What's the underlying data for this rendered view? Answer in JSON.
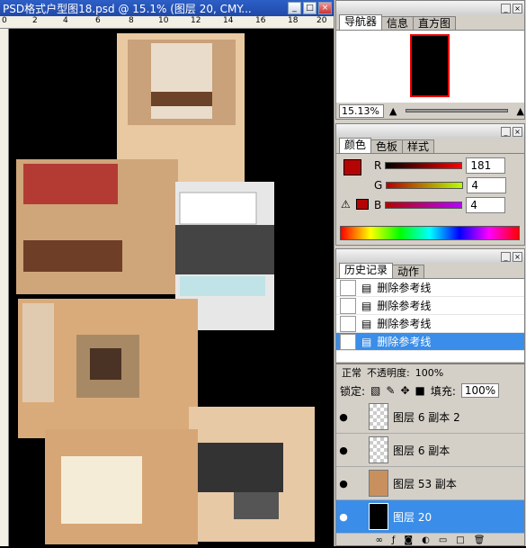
{
  "document": {
    "title": "PSD格式户型图18.psd @ 15.1% (图层 20, CMY...",
    "window_buttons": [
      "_",
      "□",
      "×"
    ],
    "ruler_ticks": [
      "0",
      "2",
      "4",
      "6",
      "8",
      "10",
      "12",
      "14",
      "16",
      "18",
      "20"
    ]
  },
  "navigator": {
    "tabs": [
      "导航器",
      "信息",
      "直方图"
    ],
    "zoom": "15.13%"
  },
  "color": {
    "tabs": [
      "颜色",
      "色板",
      "样式"
    ],
    "channels": [
      {
        "label": "R",
        "value": "181",
        "gradient": "linear-gradient(90deg,#000,#f00)"
      },
      {
        "label": "G",
        "value": "4",
        "gradient": "linear-gradient(90deg,#b50000,#b5ff00)"
      },
      {
        "label": "B",
        "value": "4",
        "gradient": "linear-gradient(90deg,#b50400,#b504ff)"
      }
    ],
    "foreground": "#b50404"
  },
  "history": {
    "tabs": [
      "历史记录",
      "动作"
    ],
    "items": [
      "删除参考线",
      "删除参考线",
      "删除参考线",
      "删除参考线"
    ]
  },
  "layers": {
    "blend_mode": "正常",
    "opacity_label": "不透明度:",
    "opacity": "100%",
    "lock_label": "锁定:",
    "fill_label": "填充:",
    "fill": "100%",
    "items": [
      {
        "name": "图层 6 副本 2"
      },
      {
        "name": "图层 6 副本"
      },
      {
        "name": "图层 53 副本"
      },
      {
        "name": "图层 20"
      }
    ]
  }
}
